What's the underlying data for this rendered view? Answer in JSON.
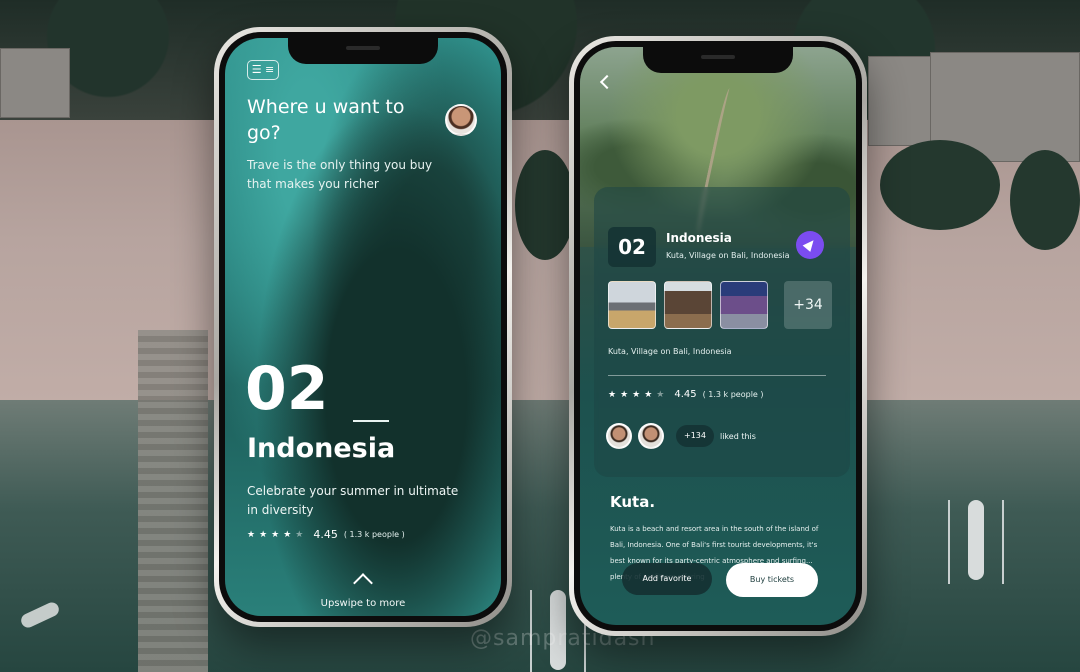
{
  "watermark": "@sampratidash",
  "screen_one": {
    "menu_label": "☰ ≡",
    "title": "Where u want to go?",
    "subtitle": "Trave is the only thing you buy that makes you richer",
    "number": "02",
    "country": "Indonesia",
    "description": "Celebrate your summer in ultimate in diversity",
    "rating": {
      "stars_filled": 4,
      "stars_total": 5,
      "value": "4.45",
      "people": "( 1.3 k people )"
    },
    "swipe_label": "Upswipe to more"
  },
  "screen_two": {
    "card": {
      "number": "02",
      "country": "Indonesia",
      "location": "Kuta, Village on Bali, Indonesia",
      "more_photos": "+34",
      "location_full": "Kuta, Village on Bali, Indonesia",
      "rating": {
        "stars_filled": 4,
        "stars_total": 5,
        "value": "4.45",
        "people": "( 1.3 k people )"
      },
      "liked_count": "+134",
      "liked_text": "liked this"
    },
    "place_title": "Kuta.",
    "place_description": "Kuta is a beach and resort area in the south of the island of Bali, Indonesia. One of Bali's first tourist developments, it's best known for its party-centric atmosphere and surfing... plenty of outfitters offering",
    "buttons": {
      "favorite": "Add favorite",
      "tickets": "Buy tickets"
    },
    "accent_color": "#7b4cf0"
  }
}
